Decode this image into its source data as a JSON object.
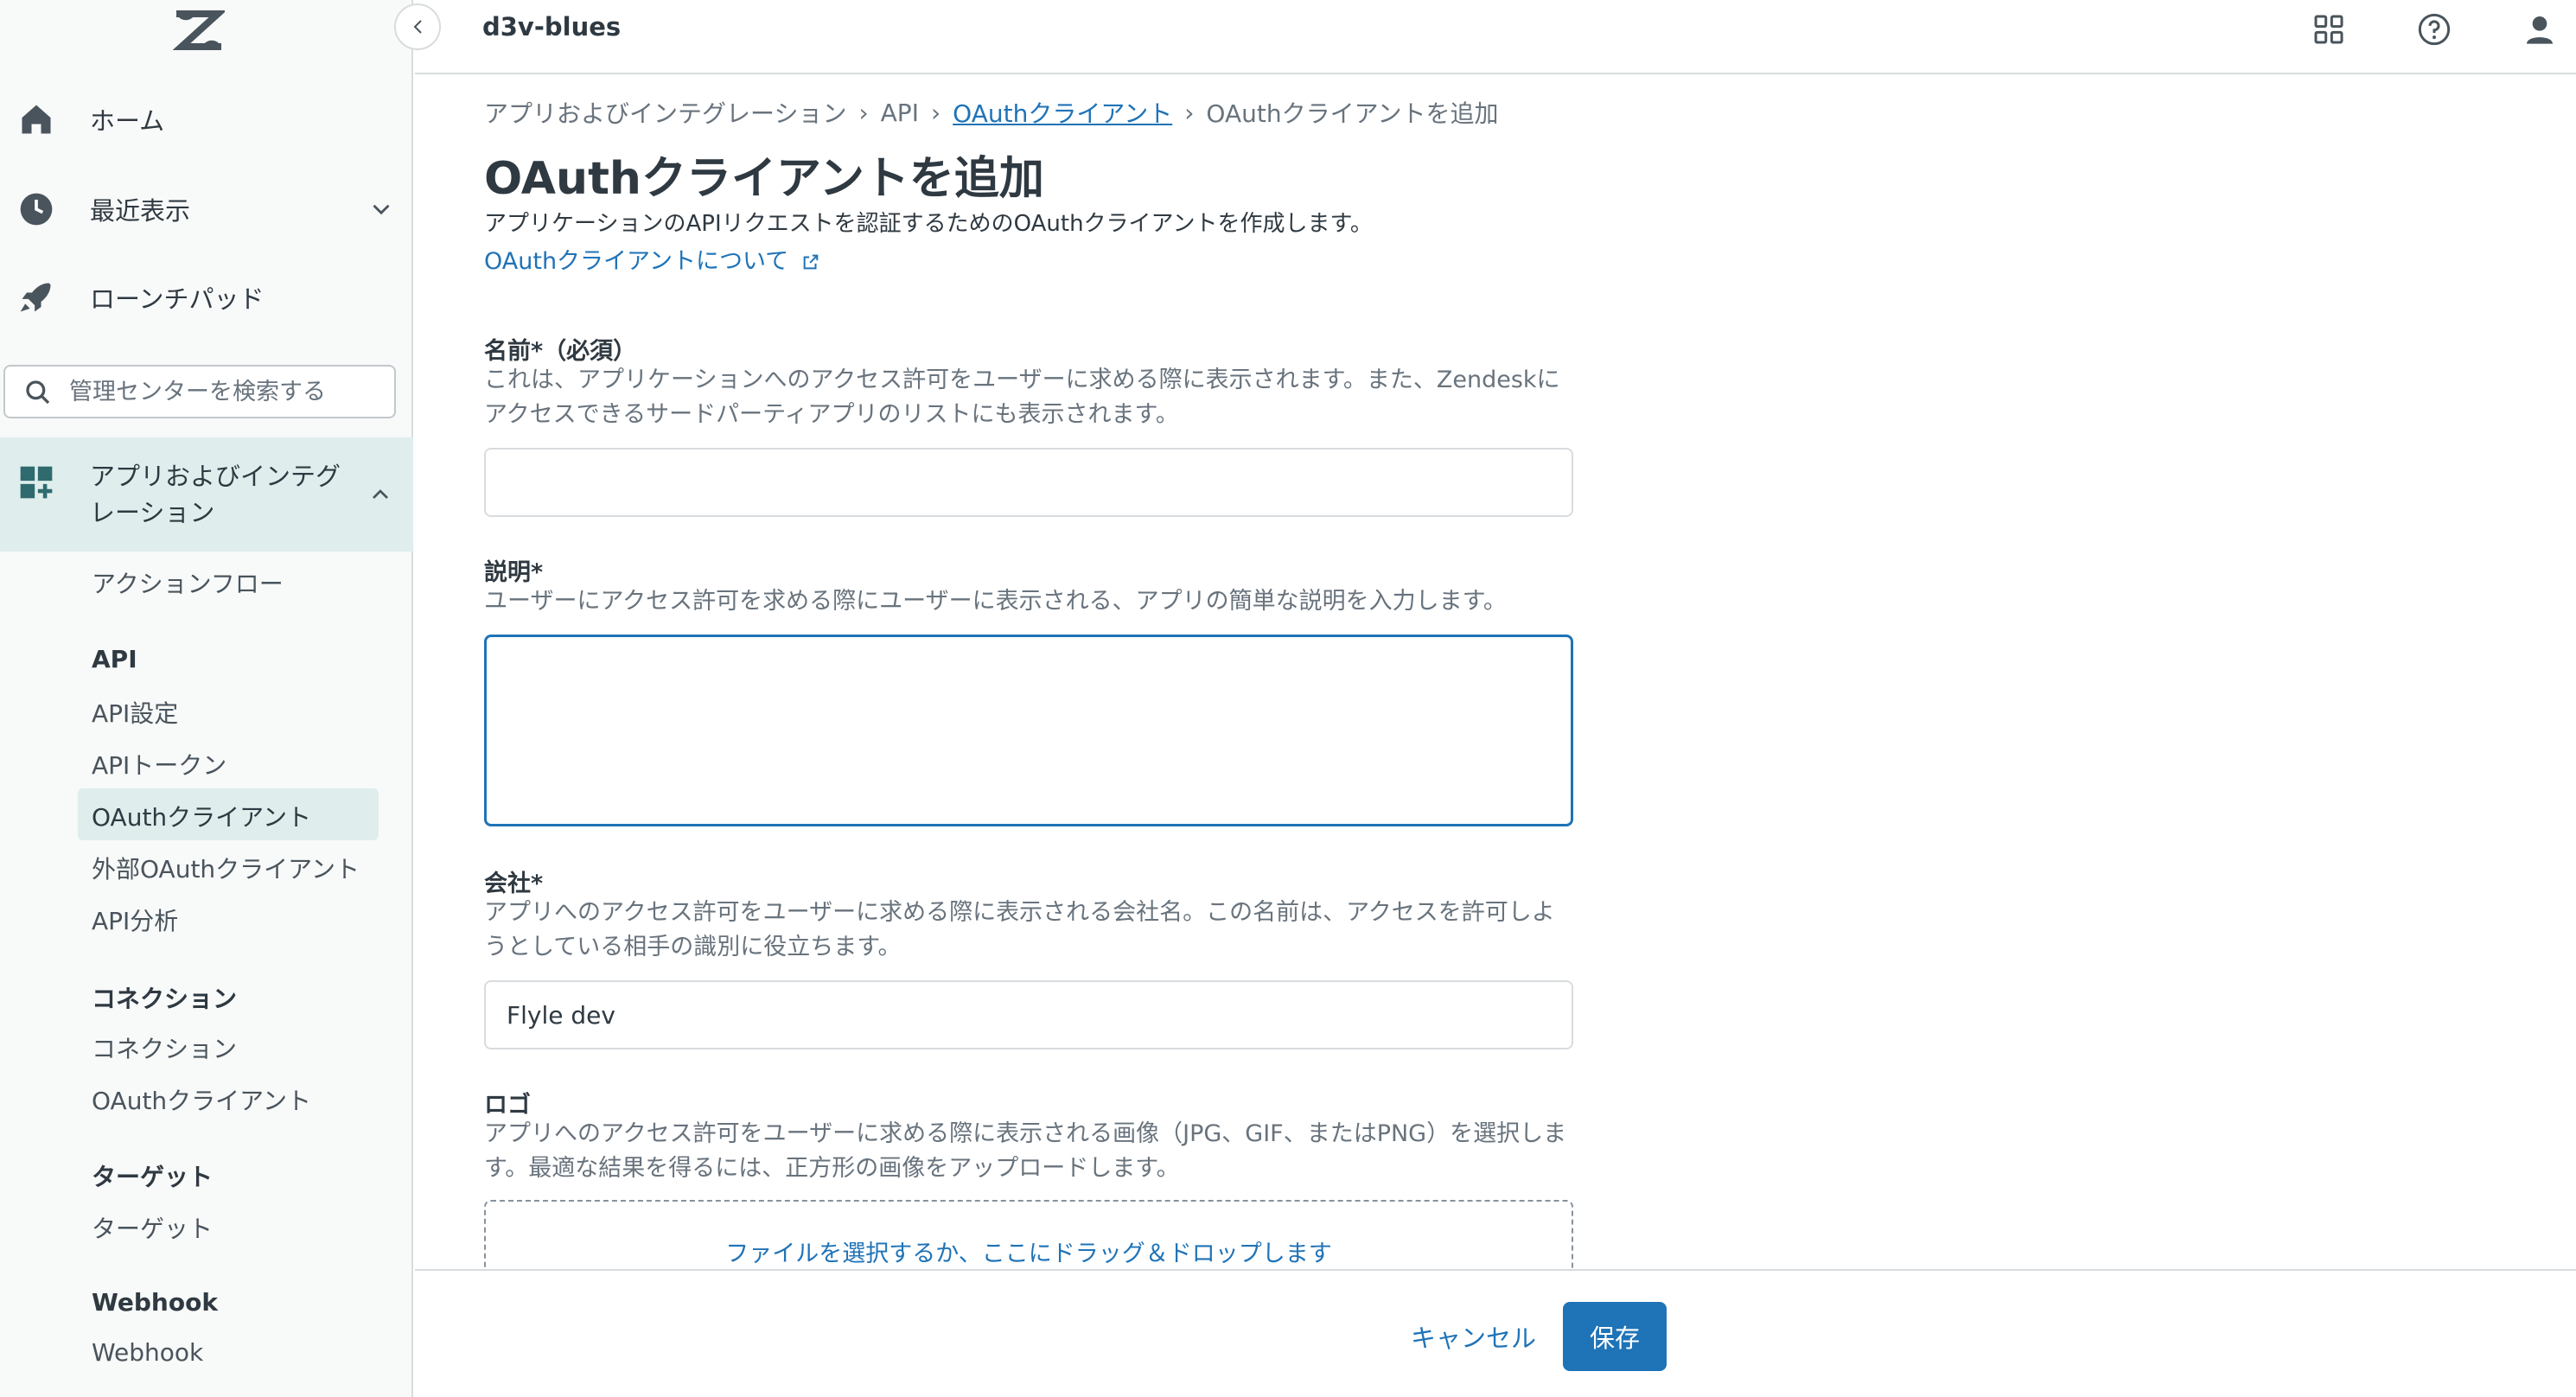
{
  "header": {
    "instance_name": "d3v-blues",
    "icons": [
      "products-grid-icon",
      "help-icon",
      "user-profile-icon"
    ]
  },
  "sidebar": {
    "logo": "zendesk-logo",
    "home_label": "ホーム",
    "recent_label": "最近表示",
    "launchpad_label": "ローンチパッド",
    "search_placeholder": "管理センターを検索する",
    "apps_section_label": "アプリおよびインテグレーション",
    "items": {
      "actions_flow": "アクションフロー",
      "api_heading": "API",
      "api_settings": "API設定",
      "api_tokens": "APIトークン",
      "oauth_clients": "OAuthクライアント",
      "external_oauth_clients": "外部OAuthクライアント",
      "api_analytics": "API分析",
      "connections_heading": "コネクション",
      "connections": "コネクション",
      "connections_oauth_clients": "OAuthクライアント",
      "targets_heading": "ターゲット",
      "targets": "ターゲット",
      "webhook_heading": "Webhook",
      "webhook": "Webhook"
    },
    "active_item": "OAuthクライアント"
  },
  "breadcrumb": {
    "items": [
      "アプリおよびインテグレーション",
      "API",
      "OAuthクライアント",
      "OAuthクライアントを追加"
    ],
    "separator": "›"
  },
  "page": {
    "title": "OAuthクライアントを追加",
    "description": "アプリケーションのAPIリクエストを認証するためのOAuthクライアントを作成します。",
    "about_link": "OAuthクライアントについて"
  },
  "form": {
    "name": {
      "label": "名前*（必須）",
      "hint": "これは、アプリケーションへのアクセス許可をユーザーに求める際に表示されます。また、Zendeskにアクセスできるサードパーティアプリのリストにも表示されます。",
      "value": ""
    },
    "description": {
      "label": "説明*",
      "hint": "ユーザーにアクセス許可を求める際にユーザーに表示される、アプリの簡単な説明を入力します。",
      "value": ""
    },
    "company": {
      "label": "会社*",
      "hint": "アプリへのアクセス許可をユーザーに求める際に表示される会社名。この名前は、アクセスを許可しようとしている相手の識別に役立ちます。",
      "value": "Flyle dev"
    },
    "logo": {
      "label": "ロゴ",
      "hint": "アプリへのアクセス許可をユーザーに求める際に表示される画像（JPG、GIF、またはPNG）を選択します。最適な結果を得るには、正方形の画像をアップロードします。",
      "dropzone_text": "ファイルを選択するか、ここにドラッグ＆ドロップします"
    }
  },
  "footer": {
    "cancel_label": "キャンセル",
    "save_label": "保存"
  },
  "colors": {
    "accent": "#1f73b7",
    "sidebar_active": "#dfeeed",
    "sidebar_bg": "#f8f9f9",
    "text": "#2f3941",
    "muted_text": "#68737d"
  }
}
